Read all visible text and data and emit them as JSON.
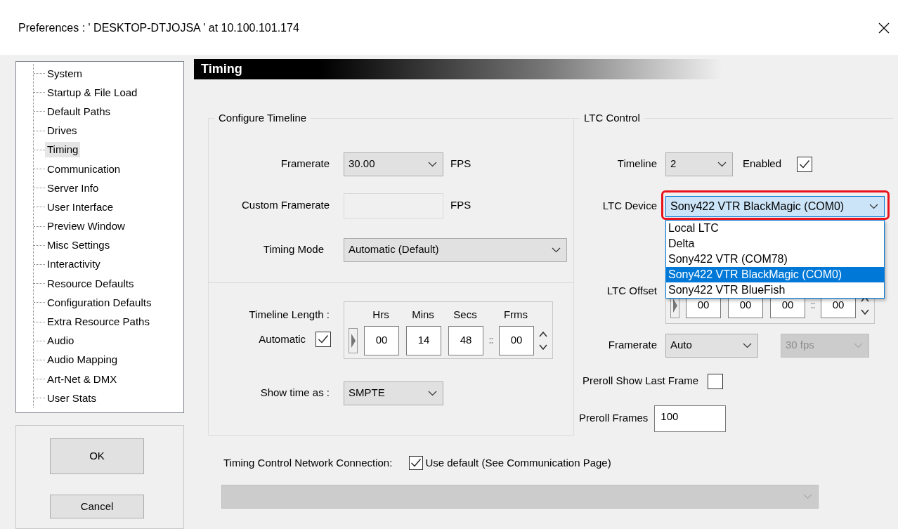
{
  "window": {
    "title": "Preferences  :  ' DESKTOP-DTJOJSA '  at  10.100.101.174"
  },
  "sidebar": {
    "items": [
      {
        "label": "System",
        "selected": false
      },
      {
        "label": "Startup & File Load",
        "selected": false
      },
      {
        "label": "Default Paths",
        "selected": false
      },
      {
        "label": "Drives",
        "selected": false
      },
      {
        "label": "Timing",
        "selected": true
      },
      {
        "label": "Communication",
        "selected": false
      },
      {
        "label": "Server Info",
        "selected": false
      },
      {
        "label": "User Interface",
        "selected": false
      },
      {
        "label": "Preview Window",
        "selected": false
      },
      {
        "label": "Misc Settings",
        "selected": false
      },
      {
        "label": "Interactivity",
        "selected": false
      },
      {
        "label": "Resource Defaults",
        "selected": false
      },
      {
        "label": "Configuration Defaults",
        "selected": false
      },
      {
        "label": "Extra Resource Paths",
        "selected": false
      },
      {
        "label": "Audio",
        "selected": false
      },
      {
        "label": "Audio Mapping",
        "selected": false
      },
      {
        "label": "Art-Net & DMX",
        "selected": false
      },
      {
        "label": "User Stats",
        "selected": false
      }
    ]
  },
  "buttons": [
    {
      "label": "OK"
    },
    {
      "label": "Cancel"
    }
  ],
  "panel_title": "Timing",
  "configure_timeline": {
    "title": "Configure Timeline",
    "framerate": {
      "label": "Framerate",
      "value": "30.00",
      "unit": "FPS"
    },
    "custom_framerate": {
      "label": "Custom Framerate",
      "unit": "FPS",
      "disabled": true
    },
    "timing_mode": {
      "label": "Timing Mode",
      "value": "Automatic (Default)"
    },
    "timeline_length": {
      "label": "Timeline Length :",
      "automatic_label": "Automatic",
      "automatic_checked": true,
      "headers": [
        "Hrs",
        "Mins",
        "Secs",
        "Frms"
      ],
      "values": [
        "00",
        "14",
        "48",
        "00"
      ]
    },
    "show_time_as": {
      "label": "Show time as :",
      "value": "SMPTE"
    }
  },
  "ltc_control": {
    "title": "LTC Control",
    "timeline": {
      "label": "Timeline",
      "value": "2"
    },
    "enabled": {
      "label": "Enabled",
      "checked": true
    },
    "device": {
      "label": "LTC Device",
      "value": "Sony422 VTR BlackMagic (COM0)",
      "expanded": true,
      "highlighted": true,
      "options": [
        {
          "label": "Local LTC",
          "selected": false
        },
        {
          "label": "Delta",
          "selected": false
        },
        {
          "label": "Sony422 VTR (COM78)",
          "selected": false
        },
        {
          "label": "Sony422 VTR BlackMagic (COM0)",
          "selected": true
        },
        {
          "label": "Sony422 VTR BlueFish",
          "selected": false
        }
      ]
    },
    "offset": {
      "label": "LTC Offset",
      "values": [
        "00",
        "00",
        "00",
        "00"
      ]
    },
    "framerate": {
      "label": "Framerate",
      "value": "Auto",
      "rate_value": "30 fps",
      "rate_disabled": true
    },
    "preroll_show_last_frame": {
      "label": "Preroll Show Last Frame",
      "checked": false
    },
    "preroll_frames": {
      "label": "Preroll Frames",
      "value": "100"
    }
  },
  "network": {
    "label": "Timing Control Network Connection:",
    "use_default": {
      "label": "Use default (See Communication Page)",
      "checked": true
    },
    "connection_disabled": true
  }
}
